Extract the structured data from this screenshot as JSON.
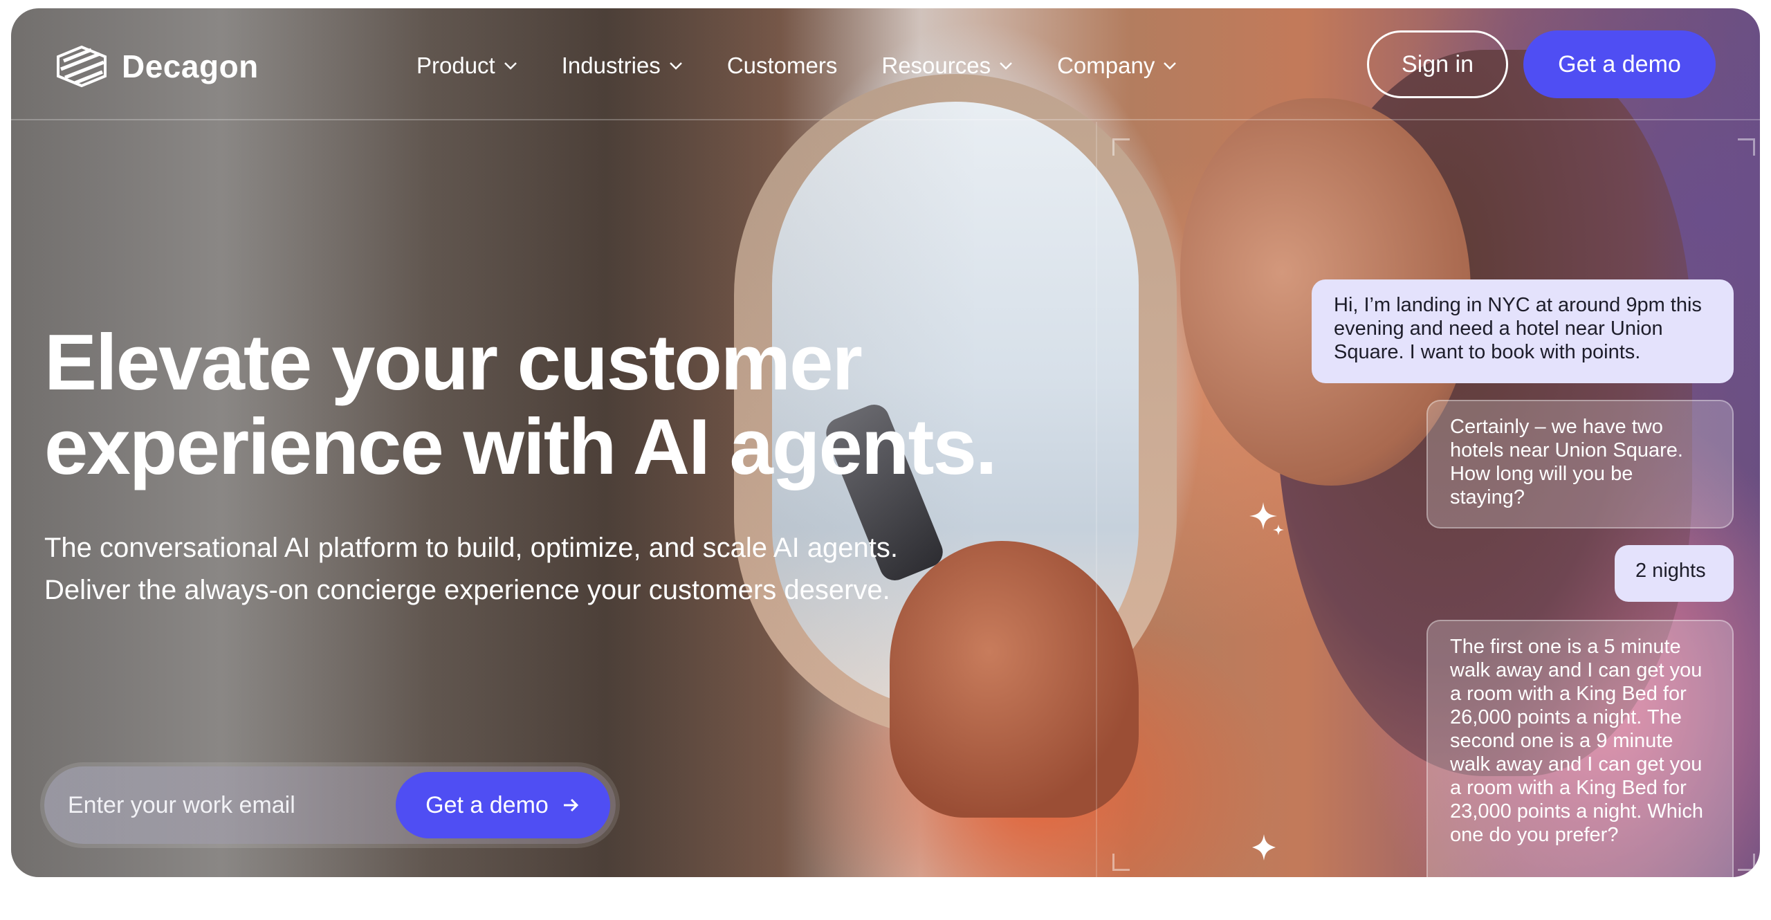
{
  "brand": {
    "name": "Decagon",
    "logo_icon": "decagon-logo-icon"
  },
  "nav": {
    "items": [
      {
        "label": "Product",
        "has_dropdown": true
      },
      {
        "label": "Industries",
        "has_dropdown": true
      },
      {
        "label": "Customers",
        "has_dropdown": false
      },
      {
        "label": "Resources",
        "has_dropdown": true
      },
      {
        "label": "Company",
        "has_dropdown": true
      }
    ],
    "sign_in_label": "Sign in",
    "demo_label": "Get a demo"
  },
  "hero": {
    "headline_line1": "Elevate your customer",
    "headline_line2": "experience with AI agents.",
    "sub_line1": "The conversational AI platform to build, optimize, and scale AI agents.",
    "sub_line2": "Deliver the always-on concierge experience your customers deserve."
  },
  "form": {
    "email_placeholder": "Enter your work email",
    "submit_label": "Get a demo"
  },
  "chat": {
    "messages": [
      {
        "role": "user",
        "text": "Hi, I’m landing in NYC at around 9pm this evening and need a hotel near Union Square. I want to book with points."
      },
      {
        "role": "agent",
        "text": "Certainly – we have two hotels near Union Square. How long will you be staying?"
      },
      {
        "role": "user",
        "text": "2 nights"
      },
      {
        "role": "agent",
        "text": "The first one is a 5 minute walk away and I can get you a room with a King Bed for 26,000 points a night. The second one is a 9 minute walk away and I can get you a room with a King Bed for 23,000 points a night. Which one do you prefer?"
      }
    ]
  },
  "colors": {
    "accent": "#4f4ef3",
    "user_bubble": "#e4e2fc",
    "text_light": "#ffffff"
  }
}
